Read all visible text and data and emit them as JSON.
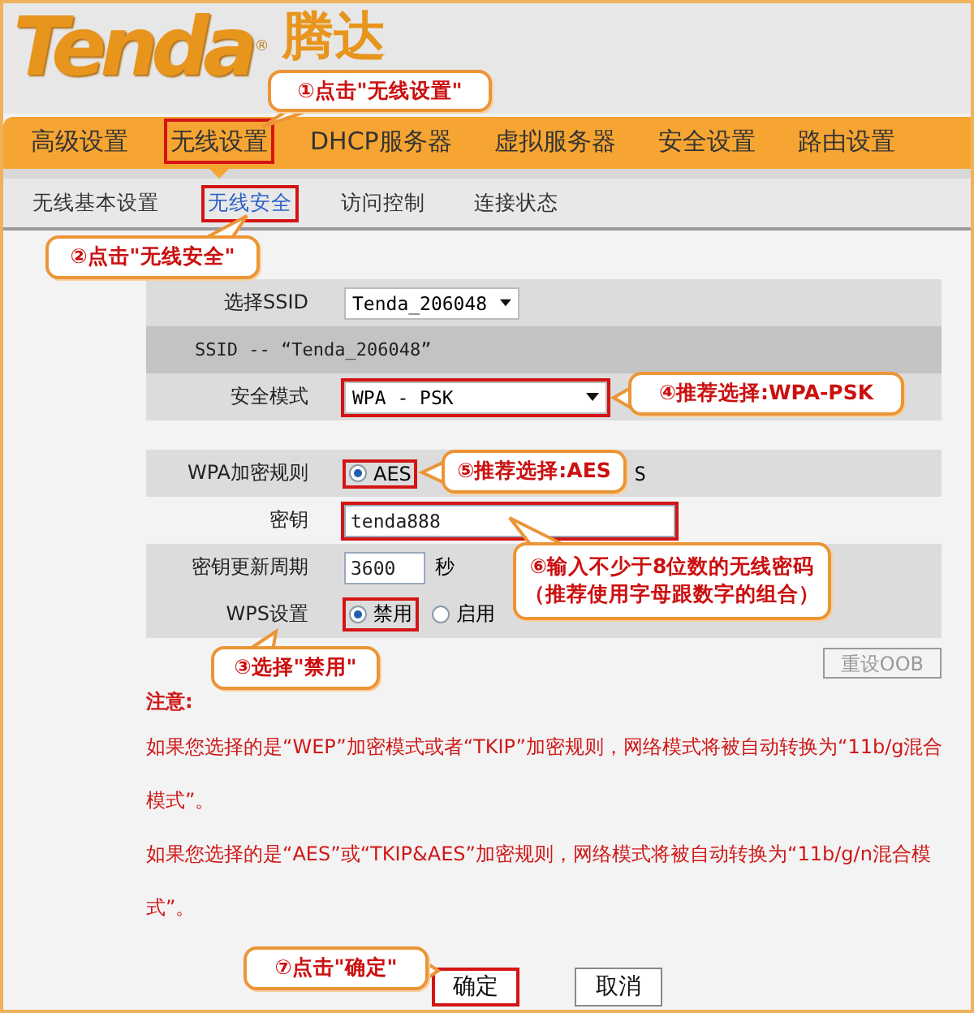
{
  "logo": {
    "brand": "Tenda",
    "mark": "®",
    "chinese": "腾达"
  },
  "nav": [
    {
      "label": "高级设置",
      "selected": false,
      "highlighted": false
    },
    {
      "label": "无线设置",
      "selected": true,
      "highlighted": true
    },
    {
      "label": "DHCP服务器",
      "selected": false,
      "highlighted": false
    },
    {
      "label": "虚拟服务器",
      "selected": false,
      "highlighted": false
    },
    {
      "label": "安全设置",
      "selected": false,
      "highlighted": false
    },
    {
      "label": "路由设置",
      "selected": false,
      "highlighted": false
    }
  ],
  "subnav": [
    {
      "label": "无线基本设置",
      "selected": false,
      "highlighted": false
    },
    {
      "label": "无线安全",
      "selected": true,
      "highlighted": true
    },
    {
      "label": "访问控制",
      "selected": false,
      "highlighted": false
    },
    {
      "label": "连接状态",
      "selected": false,
      "highlighted": false
    }
  ],
  "form": {
    "sections": [
      [
        {
          "kind": "select",
          "label": "选择SSID",
          "value": "Tenda_206048",
          "wide": false,
          "highlighted": false
        },
        {
          "kind": "info",
          "text": "SSID -- “Tenda_206048”"
        },
        {
          "kind": "select",
          "label": "安全模式",
          "value": "WPA - PSK",
          "wide": true,
          "highlighted": true
        }
      ],
      [
        {
          "kind": "radio",
          "label": "WPA加密规则",
          "options": [
            {
              "label": "AES",
              "selected": true,
              "highlighted": true
            }
          ],
          "covered_text": "S"
        },
        {
          "kind": "key_input",
          "label": "密钥",
          "value": "tenda888",
          "highlighted": true
        },
        {
          "kind": "short_input",
          "label": "密钥更新周期",
          "value": "3600",
          "unit": "秒"
        },
        {
          "kind": "radio",
          "label": "WPS设置",
          "options": [
            {
              "label": "禁用",
              "selected": true,
              "highlighted": true
            },
            {
              "label": "启用",
              "selected": false,
              "highlighted": false
            }
          ]
        }
      ]
    ],
    "reset_button": {
      "label": "重设OOB",
      "disabled": true
    }
  },
  "notes": {
    "title": "注意:",
    "paragraphs": [
      "如果您选择的是“WEP”加密模式或者“TKIP”加密规则，网络模式将被自动转换为“11b/g混合模式”。",
      "如果您选择的是“AES”或“TKIP&AES”加密规则，网络模式将被自动转换为“11b/g/n混合模式”。"
    ]
  },
  "actions": [
    {
      "label": "确定",
      "highlighted": true
    },
    {
      "label": "取消",
      "highlighted": false
    }
  ],
  "callouts": [
    "①点击\"无线设置\"",
    "②点击\"无线安全\"",
    "③选择\"禁用\"",
    "④推荐选择:WPA-PSK",
    "⑤推荐选择:AES",
    "⑥输入不少于8位数的无线密码（推荐使用字母跟数字的组合）",
    "⑦点击\"确定\""
  ]
}
